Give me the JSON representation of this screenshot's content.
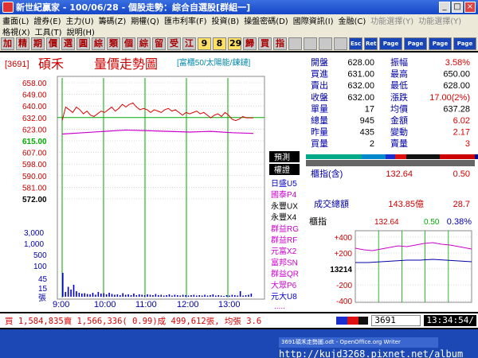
{
  "window": {
    "title": "新世紀贏家 - 100/06/28 - 個股走勢：綜合自選股[群組一]"
  },
  "menu": {
    "row1": [
      "畫面(L)",
      "證券(E)",
      "主力(U)",
      "籌碼(Z)",
      "期權(Q)",
      "匯市利率(F)",
      "投資(B)",
      "操盤密碼(D)",
      "國際資訊(I)",
      "金融(C)",
      "功能選擇(Y)",
      "功能選擇(Y)"
    ],
    "row2": [
      "格視(X)",
      "工具(T)",
      "說明(H)"
    ]
  },
  "toolbar": {
    "buttons": [
      "加",
      "精",
      "期",
      "價",
      "選",
      "圓",
      "綜",
      "類",
      "個",
      "綜",
      "留",
      "受",
      "江",
      "9",
      "8",
      "29",
      "歸",
      "買",
      "指",
      "",
      "",
      "",
      "",
      "Esc",
      "Ret",
      "Page Up",
      "Page Dn",
      "Page Up",
      "Page Dn"
    ]
  },
  "stock": {
    "code": "3691",
    "name": "碩禾",
    "chart_title": "量價走勢圖",
    "group": "富櫃50/太陽能/鍊鏈"
  },
  "quote": [
    {
      "l1": "開盤",
      "v1": "628.00",
      "l2": "振幅",
      "v2": "3.58%"
    },
    {
      "l1": "買進",
      "v1": "631.00",
      "l2": "最高",
      "v2": "650.00"
    },
    {
      "l1": "賣出",
      "v1": "632.00",
      "l2": "最低",
      "v2": "628.00"
    },
    {
      "l1": "收盤",
      "v1": "632.00",
      "l2": "漲跌",
      "v2": "17.00(2%)"
    },
    {
      "l1": "單量",
      "v1": "17",
      "l2": "均價",
      "v2": "637.28"
    },
    {
      "l1": "總量",
      "v1": "945",
      "l2": "金額",
      "v2": "6.02"
    },
    {
      "l1": "昨量",
      "v1": "435",
      "l2": "變動",
      "v2": "2.17"
    },
    {
      "l1": "買量",
      "v1": "2",
      "l2": "賣量",
      "v2": "3"
    }
  ],
  "side_panel": {
    "predict": "預測",
    "rights": "權證",
    "broker_list": [
      "日盛U5",
      "國泰P4",
      "永豐UX",
      "永豐X4",
      "群益RG",
      "群益RF",
      "元富X2",
      "富邦SN",
      "群益QR",
      "大眾P6",
      "元大U8"
    ],
    "more": "....."
  },
  "index_info": {
    "label": "櫃指(含)",
    "value": "132.64",
    "change": "0.50",
    "turnover_label": "成交總額",
    "turnover": "143.85億",
    "turnover_change": "28.7"
  },
  "mini_index": {
    "label": "櫃指",
    "value": "132.64",
    "change": "0.50",
    "pct": "0.38%",
    "y_ticks": [
      "+400",
      "+200",
      "13214",
      "-200",
      "-400"
    ]
  },
  "chart_data": {
    "type": "line",
    "price_ticks": [
      "658.00",
      "649.00",
      "640.00",
      "632.00",
      "623.00",
      "615.00",
      "607.00",
      "598.00",
      "590.00",
      "581.00",
      "572.00"
    ],
    "volume_ticks": [
      "3,000",
      "1,000",
      "500",
      "100",
      "45",
      "15",
      "張"
    ],
    "x_ticks": [
      "9:00",
      "10:00",
      "11:00",
      "12:00",
      "13:00"
    ],
    "price_range": [
      572,
      658
    ],
    "price_series": [
      [
        0,
        630
      ],
      [
        5,
        640
      ],
      [
        10,
        638
      ],
      [
        15,
        636
      ],
      [
        20,
        640
      ],
      [
        25,
        638
      ],
      [
        30,
        635
      ],
      [
        35,
        637
      ],
      [
        40,
        634
      ],
      [
        45,
        633
      ],
      [
        50,
        635
      ],
      [
        55,
        637
      ],
      [
        60,
        636
      ],
      [
        65,
        638
      ],
      [
        70,
        640
      ],
      [
        75,
        637
      ],
      [
        80,
        639
      ],
      [
        85,
        642
      ],
      [
        90,
        640
      ],
      [
        95,
        642
      ],
      [
        100,
        643
      ],
      [
        105,
        640
      ],
      [
        110,
        638
      ],
      [
        115,
        639
      ],
      [
        120,
        638
      ],
      [
        125,
        636
      ],
      [
        130,
        638
      ],
      [
        135,
        637
      ],
      [
        140,
        636
      ],
      [
        145,
        638
      ],
      [
        150,
        639
      ],
      [
        155,
        637
      ],
      [
        160,
        638
      ],
      [
        165,
        636
      ],
      [
        170,
        634
      ],
      [
        175,
        636
      ],
      [
        180,
        635
      ],
      [
        185,
        636
      ],
      [
        190,
        637
      ],
      [
        195,
        635
      ],
      [
        200,
        636
      ],
      [
        205,
        634
      ],
      [
        210,
        632
      ],
      [
        215,
        634
      ],
      [
        220,
        635
      ],
      [
        225,
        633
      ],
      [
        230,
        636
      ],
      [
        235,
        634
      ],
      [
        240,
        631
      ],
      [
        245,
        630
      ],
      [
        250,
        631
      ],
      [
        255,
        633
      ],
      [
        260,
        632
      ],
      [
        265,
        632
      ],
      [
        270,
        632
      ]
    ],
    "avg_series": [
      [
        0,
        620
      ],
      [
        30,
        621
      ],
      [
        60,
        622
      ],
      [
        90,
        623
      ],
      [
        120,
        622.5
      ],
      [
        150,
        622
      ],
      [
        180,
        621.5
      ],
      [
        210,
        622
      ],
      [
        240,
        621
      ],
      [
        270,
        620.5
      ]
    ],
    "volume_series": [
      60,
      12,
      25,
      18,
      30,
      14,
      10,
      8,
      9,
      7,
      6,
      10,
      5,
      12,
      8,
      9,
      6,
      10,
      7,
      5,
      6,
      4,
      9,
      5,
      6,
      4,
      8,
      4,
      6,
      5,
      4,
      6,
      5,
      4,
      7,
      4,
      5,
      3,
      4,
      6,
      3,
      5,
      4,
      3,
      5,
      4,
      3,
      4,
      5,
      3,
      4,
      3,
      5,
      3,
      4,
      6,
      3,
      4,
      3,
      2,
      4,
      3,
      5,
      4,
      3,
      14,
      3,
      4,
      5,
      8
    ],
    "index_series": [
      [
        0,
        260
      ],
      [
        20,
        240
      ],
      [
        40,
        230
      ],
      [
        60,
        250
      ],
      [
        80,
        270
      ],
      [
        100,
        290
      ],
      [
        120,
        280
      ],
      [
        140,
        300
      ],
      [
        160,
        320
      ],
      [
        180,
        330
      ],
      [
        200,
        310
      ],
      [
        220,
        300
      ],
      [
        240,
        280
      ],
      [
        260,
        260
      ],
      [
        270,
        250
      ]
    ],
    "index_avg_series": [
      [
        0,
        80
      ],
      [
        30,
        80
      ],
      [
        60,
        90
      ],
      [
        90,
        100
      ],
      [
        120,
        110
      ],
      [
        150,
        110
      ],
      [
        180,
        120
      ],
      [
        210,
        110
      ],
      [
        240,
        100
      ],
      [
        270,
        90
      ]
    ]
  },
  "status": {
    "quote_line": "買 1,584,835賣 1,566,336( 0.99)成 499,612張, 均張 3.6",
    "code_input": "3691",
    "clock": "13:34:54/"
  },
  "taskbar": {
    "task": "3691碩禾走勢圖.odt - OpenOffice.org Writer",
    "url": "http://kujd3268.pixnet.net/album"
  }
}
